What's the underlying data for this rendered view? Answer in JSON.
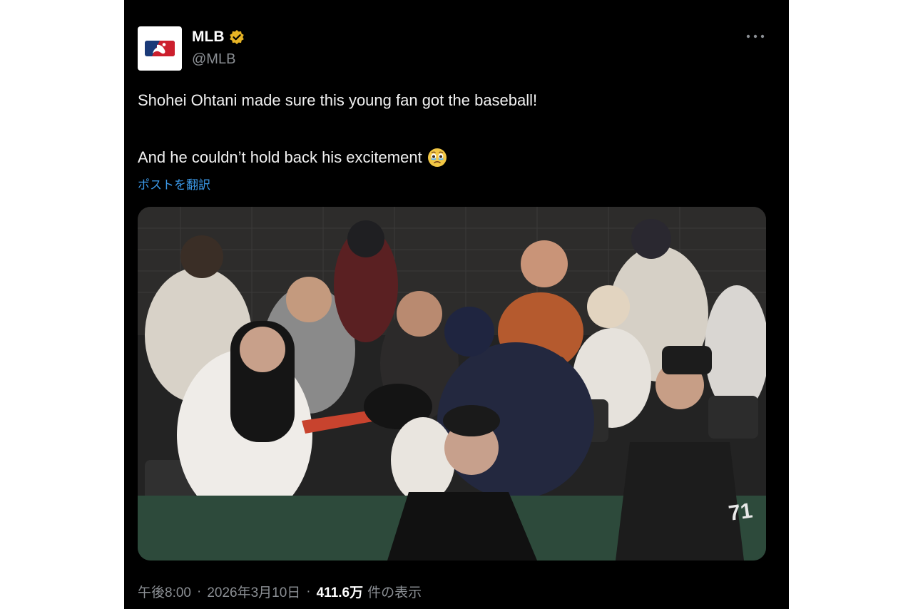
{
  "author": {
    "name": "MLB",
    "handle": "@MLB"
  },
  "post": {
    "text_line1": "Shohei Ohtani made sure this young fan got the baseball!",
    "text_line2": "And he couldn’t hold back his excitement",
    "emoji": "holding-back-tears-face-icon",
    "translate_label": "ポストを翻訳"
  },
  "meta": {
    "time": "午後8:00",
    "separator": "·",
    "date": "2026年3月10日",
    "views": "411.6万",
    "views_label": "件の表示"
  },
  "icons": {
    "logo": "mlb-logo",
    "verified": "verified-badge-icon",
    "more": "more-options-icon"
  },
  "colors": {
    "background": "#000000",
    "link": "#3b99e8",
    "verified_badge": "#e6b325",
    "secondary_text": "#8b8f94",
    "mlb_blue": "#1a3a78",
    "mlb_red": "#cc1f2d"
  }
}
